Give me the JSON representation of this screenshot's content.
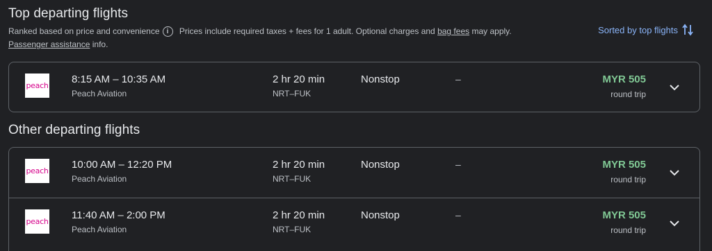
{
  "top_section": {
    "title": "Top departing flights",
    "ranked_text": "Ranked based on price and convenience",
    "info_icon": "info-icon",
    "prices_text": "Prices include required taxes + fees for 1 adult. Optional charges and",
    "bag_fees_link": "bag fees",
    "may_apply": "may apply.",
    "passenger_assistance_link": "Passenger assistance",
    "info_suffix": "info.",
    "sort_label": "Sorted by top flights",
    "sort_icon": "sort-arrows-icon"
  },
  "other_section": {
    "title": "Other departing flights"
  },
  "flights": [
    {
      "logo_text": "peach",
      "time": "8:15 AM – 10:35 AM",
      "airline": "Peach Aviation",
      "duration": "2 hr 20 min",
      "route": "NRT–FUK",
      "stops": "Nonstop",
      "emissions": "–",
      "price": "MYR 505",
      "trip_type": "round trip"
    },
    {
      "logo_text": "peach",
      "time": "10:00 AM – 12:20 PM",
      "airline": "Peach Aviation",
      "duration": "2 hr 20 min",
      "route": "NRT–FUK",
      "stops": "Nonstop",
      "emissions": "–",
      "price": "MYR 505",
      "trip_type": "round trip"
    },
    {
      "logo_text": "peach",
      "time": "11:40 AM – 2:00 PM",
      "airline": "Peach Aviation",
      "duration": "2 hr 20 min",
      "route": "NRT–FUK",
      "stops": "Nonstop",
      "emissions": "–",
      "price": "MYR 505",
      "trip_type": "round trip"
    }
  ],
  "colors": {
    "background": "#202124",
    "price_green": "#81c995",
    "link_blue": "#8ab4f8",
    "brand_peach": "#d6008a"
  }
}
